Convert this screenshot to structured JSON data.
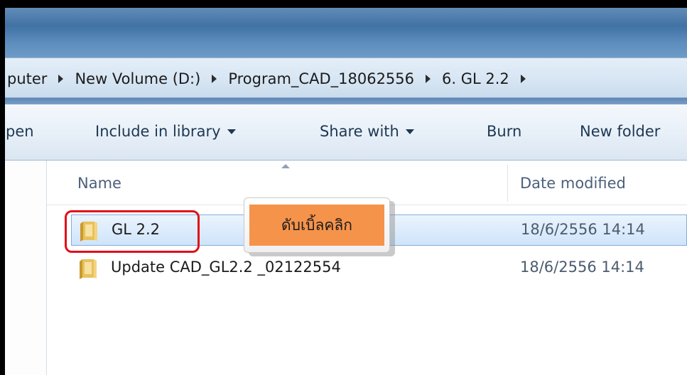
{
  "address_bar": {
    "crumbs": [
      "puter",
      "New Volume (D:)",
      "Program_CAD_18062556",
      "6. GL 2.2"
    ]
  },
  "toolbar": {
    "open_label": "pen",
    "include_label": "Include in library",
    "share_label": "Share with",
    "burn_label": "Burn",
    "new_folder_label": "New folder"
  },
  "columns": {
    "name": "Name",
    "date_modified": "Date modified"
  },
  "files": [
    {
      "name": "GL 2.2",
      "date": "18/6/2556 14:14",
      "type": "folder",
      "selected": true
    },
    {
      "name": "Update CAD_GL2.2 _02122554",
      "date": "18/6/2556 14:14",
      "type": "folder",
      "selected": false
    }
  ],
  "annotation": {
    "tooltip_text": "ดับเบิ้ลคลิก",
    "tooltip_color": "#f5934b",
    "highlight_color": "#e0101a"
  },
  "colors": {
    "title_bar": "#3f70a3",
    "selection": "#cfe4fa"
  }
}
